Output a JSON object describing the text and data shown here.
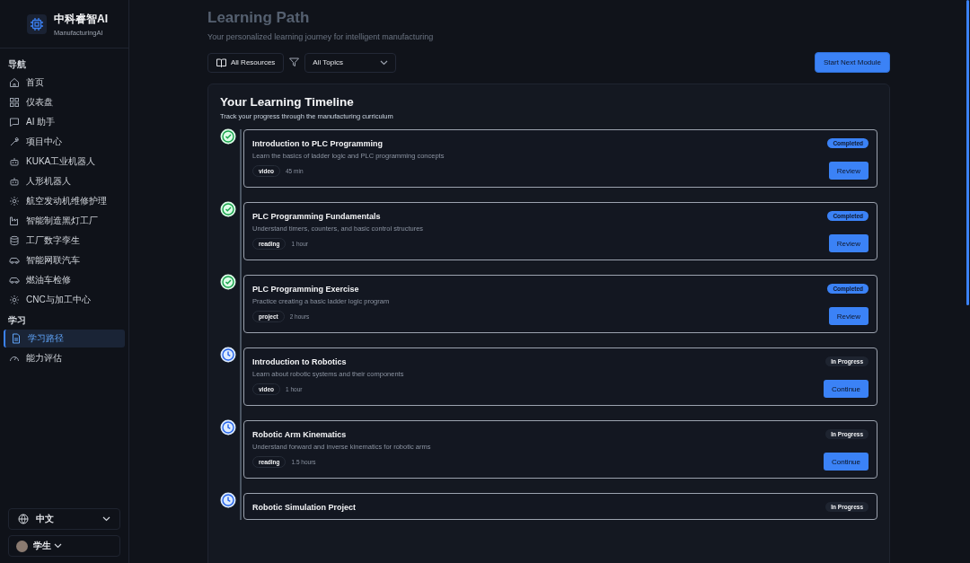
{
  "brand": {
    "name": "中科睿智AI",
    "subtitle": "ManufacturingAI"
  },
  "sidebar": {
    "sections": [
      {
        "title": "导航",
        "items": [
          {
            "label": "首页",
            "selected": false
          },
          {
            "label": "仪表盘",
            "selected": false
          },
          {
            "label": "AI 助手",
            "selected": false
          },
          {
            "label": "项目中心",
            "selected": false
          },
          {
            "label": "KUKA工业机器人",
            "selected": false
          },
          {
            "label": "人形机器人",
            "selected": false
          },
          {
            "label": "航空发动机维修护理",
            "selected": false
          },
          {
            "label": "智能制造黑灯工厂",
            "selected": false
          },
          {
            "label": "工厂数字孪生",
            "selected": false
          },
          {
            "label": "智能网联汽车",
            "selected": false
          },
          {
            "label": "燃油车检修",
            "selected": false
          },
          {
            "label": "CNC与加工中心",
            "selected": false
          }
        ]
      },
      {
        "title": "学习",
        "items": [
          {
            "label": "学习路径",
            "selected": true
          },
          {
            "label": "能力评估",
            "selected": false
          }
        ]
      }
    ],
    "language": "中文",
    "user": "学生"
  },
  "page": {
    "title": "Learning Path",
    "subtitle": "Your personalized learning journey for intelligent manufacturing"
  },
  "toolbar": {
    "resources": "All Resources",
    "topics": "All Topics",
    "action": "Start Next Module"
  },
  "timeline": {
    "title": "Your Learning Timeline",
    "subtitle": "Track your progress through the manufacturing curriculum",
    "modules": [
      {
        "kind": "completed",
        "title": "Introduction to PLC Programming",
        "description": "Learn the basics of ladder logic and PLC programming concepts",
        "badge": "Completed",
        "type": "video",
        "duration": "45 min",
        "button": "Review"
      },
      {
        "kind": "completed",
        "title": "PLC Programming Fundamentals",
        "description": "Understand timers, counters, and basic control structures",
        "badge": "Completed",
        "type": "reading",
        "duration": "1 hour",
        "button": "Review"
      },
      {
        "kind": "completed",
        "title": "PLC Programming Exercise",
        "description": "Practice creating a basic ladder logic program",
        "badge": "Completed",
        "type": "project",
        "duration": "2 hours",
        "button": "Review"
      },
      {
        "kind": "in_progress",
        "title": "Introduction to Robotics",
        "description": "Learn about robotic systems and their components",
        "badge": "In Progress",
        "type": "video",
        "duration": "1 hour",
        "button": "Continue"
      },
      {
        "kind": "in_progress",
        "title": "Robotic Arm Kinematics",
        "description": "Understand forward and inverse kinematics for robotic arms",
        "badge": "In Progress",
        "type": "reading",
        "duration": "1.5 hours",
        "button": "Continue"
      },
      {
        "kind": "in_progress",
        "title": "Robotic Simulation Project",
        "badge": "In Progress"
      }
    ]
  }
}
